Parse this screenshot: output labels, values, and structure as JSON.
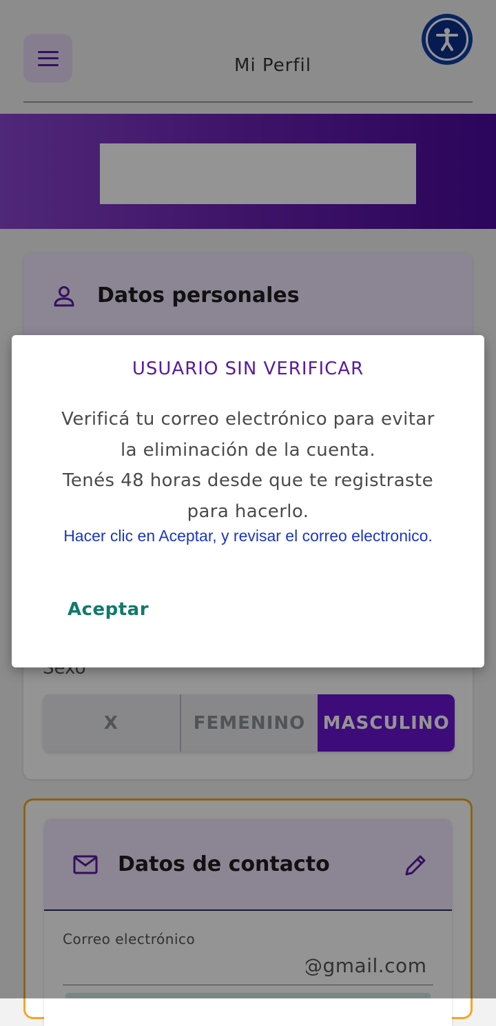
{
  "header": {
    "title": "Mi Perfil",
    "menu_icon": "hamburger-menu-icon",
    "accessibility_icon": "accessibility-person-icon"
  },
  "personal": {
    "title": "Datos personales",
    "icon": "person-outline-icon",
    "sexo_label": "Sexo",
    "sexo_options": [
      "X",
      "FEMENINO",
      "MASCULINO"
    ],
    "sexo_selected": "MASCULINO"
  },
  "contact": {
    "title": "Datos de contacto",
    "icon": "mail-icon",
    "edit_icon": "pencil-icon",
    "email_label": "Correo electrónico",
    "email_visible_suffix": "@gmail.com"
  },
  "dialog": {
    "title": "USUARIO SIN VERIFICAR",
    "body_line1": "Verificá tu correo electrónico para evitar",
    "body_line2": "la eliminación de la cuenta.",
    "body_line3": "Tenés 48 horas desde que te registraste",
    "body_line4": "para hacerlo.",
    "link_text": "Hacer clic en Aceptar, y revisar el correo electronico.",
    "accept_label": "Aceptar"
  },
  "colors": {
    "brand_purple": "#6a14d2",
    "banner_start": "#8a45d0",
    "banner_end": "#4b0a9e",
    "dialog_title": "#5a1a9c",
    "link_blue": "#1a36c9",
    "accept_teal": "#0f7a6c",
    "contact_border": "#f5a623"
  }
}
